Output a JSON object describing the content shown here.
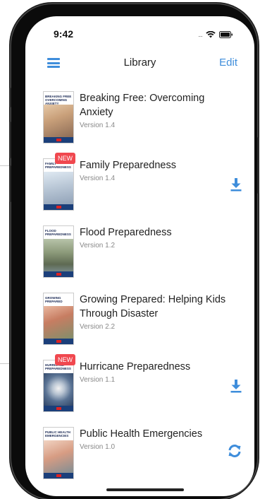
{
  "status_bar": {
    "time": "9:42",
    "signal": "...."
  },
  "navbar": {
    "title": "Library",
    "edit_label": "Edit",
    "menu_icon": "hamburger-menu-icon"
  },
  "colors": {
    "accent": "#3e8ddb",
    "badge": "#f0484f",
    "title": "#222222",
    "muted": "#888888"
  },
  "items": [
    {
      "title": "Breaking Free: Overcoming Anxiety",
      "version": "Version 1.4",
      "cover_text": "BREAKING FREE OVERCOMING ANXIETY",
      "badge": "",
      "action": ""
    },
    {
      "title": "Family Preparedness",
      "version": "Version 1.4",
      "cover_text": "FAMILY PREPAREDNESS",
      "badge": "NEW",
      "action": "download-icon"
    },
    {
      "title": "Flood Preparedness",
      "version": "Version 1.2",
      "cover_text": "FLOOD PREPAREDNESS",
      "badge": "",
      "action": ""
    },
    {
      "title": "Growing Prepared: Helping Kids Through Disaster",
      "version": "Version 2.2",
      "cover_text": "GROWING PREPARED",
      "badge": "",
      "action": ""
    },
    {
      "title": "Hurricane Preparedness",
      "version": "Version 1.1",
      "cover_text": "HURRICANE PREPAREDNESS",
      "badge": "NEW",
      "action": "download-icon"
    },
    {
      "title": "Public Health Emergencies",
      "version": "Version 1.0",
      "cover_text": "PUBLIC HEALTH EMERGENCIES",
      "badge": "",
      "action": "refresh-icon"
    }
  ]
}
